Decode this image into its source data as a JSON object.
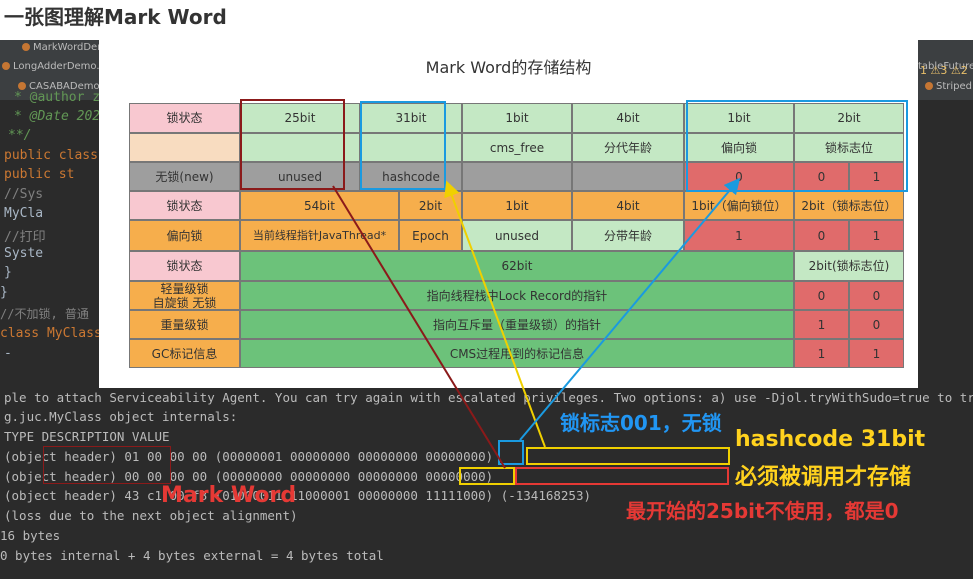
{
  "page_title": "一张图理解Mark Word",
  "ide": {
    "tabs": [
      {
        "label": "MarkWordDemo"
      },
      {
        "label": "LongAdderDemo.java"
      },
      {
        "label": "CASABADemo.java"
      },
      {
        "label": "tableFutureD"
      },
      {
        "label": "Striped"
      }
    ],
    "inspection": {
      "warn_a": "1",
      "warn_b": "3",
      "warn_c": "2"
    },
    "code_lines": [
      {
        "text": "* @author  zz"
      },
      {
        "text": "* @Date 2021"
      },
      {
        "text": "**/"
      },
      {
        "text": "public class"
      },
      {
        "text": "    public st"
      },
      {
        "text": "        //Sys"
      },
      {
        "text": "        MyCla"
      },
      {
        "text": "        //打印"
      },
      {
        "text": "        Syste"
      },
      {
        "text": "    }"
      },
      {
        "text": "}"
      },
      {
        "text": "//不加锁, 普通"
      },
      {
        "text": "class MyClass"
      },
      {
        "text": "-"
      }
    ]
  },
  "diagram": {
    "title": "Mark Word的存储结构",
    "rows": {
      "r1": {
        "state": "锁状态",
        "c25": "25bit",
        "c31": "31bit",
        "c1": "1bit",
        "c4": "4bit",
        "b1": "1bit",
        "b2": "2bit"
      },
      "r2": {
        "cms": "cms_free",
        "age": "分代年龄",
        "bias": "偏向锁",
        "flag": "锁标志位"
      },
      "r3": {
        "state": "无锁(new)",
        "unused": "unused",
        "hash": "hashcode",
        "bias": "0",
        "flag1": "0",
        "flag2": "1"
      },
      "r4": {
        "state": "锁状态",
        "c54": "54bit",
        "c2": "2bit",
        "c1": "1bit",
        "c4": "4bit",
        "b1": "1bit（偏向锁位）",
        "b2": "2bit（锁标志位）"
      },
      "r5": {
        "state": "偏向锁",
        "thread": "当前线程指针JavaThread*",
        "epoch": "Epoch",
        "unused": "unused",
        "age": "分带年龄",
        "bias": "1",
        "flag1": "0",
        "flag2": "1"
      },
      "r6": {
        "state": "锁状态",
        "c62": "62bit",
        "c2": "2bit(锁标志位)"
      },
      "r7": {
        "state": "轻量级锁\n自旋锁 无锁",
        "desc": "指向线程栈中Lock Record的指针",
        "f1": "0",
        "f2": "0"
      },
      "r8": {
        "state": "重量级锁",
        "desc": "指向互斥量（重量级锁）的指针",
        "f1": "1",
        "f2": "0"
      },
      "r9": {
        "state": "GC标记信息",
        "desc": "CMS过程用到的标记信息",
        "f1": "1",
        "f2": "1"
      }
    }
  },
  "console": {
    "lines": [
      "ple to attach Serviceability Agent. You can try again with escalated privileges. Two options: a) use -Djol.tryWithSudo=true to try",
      "g.juc.MyClass object internals:",
      "  TYPE DESCRIPTION                               VALUE",
      "      (object header)                             01 00 00 00 (00000001 00000000 00000000 00000000)",
      "      (object header)                             00 00 00 00 (00000000 00000000 00000000 00000000)",
      "      (object header)                             43 c1 00 f8 (01000011 11000001 00000000 11111000) (-134168253)",
      "      (loss due to the next object alignment)",
      " 16 bytes",
      "0 bytes internal + 4 bytes external = 4 bytes total"
    ]
  },
  "annotations": {
    "lock_flag": "锁标志001，无锁",
    "hashcode": "hashcode 31bit",
    "must_call": "必须被调用才存储",
    "first25": "最开始的25bit不使用，都是0",
    "mark_word": "Mark Word"
  },
  "colors": {
    "red_box": "#8b1a1a",
    "blue_box": "#1a9ae0",
    "yellow_box": "#f0d000",
    "yellow_text": "#ffd21e",
    "blue_text": "#2196f3",
    "red_text": "#e53935"
  }
}
